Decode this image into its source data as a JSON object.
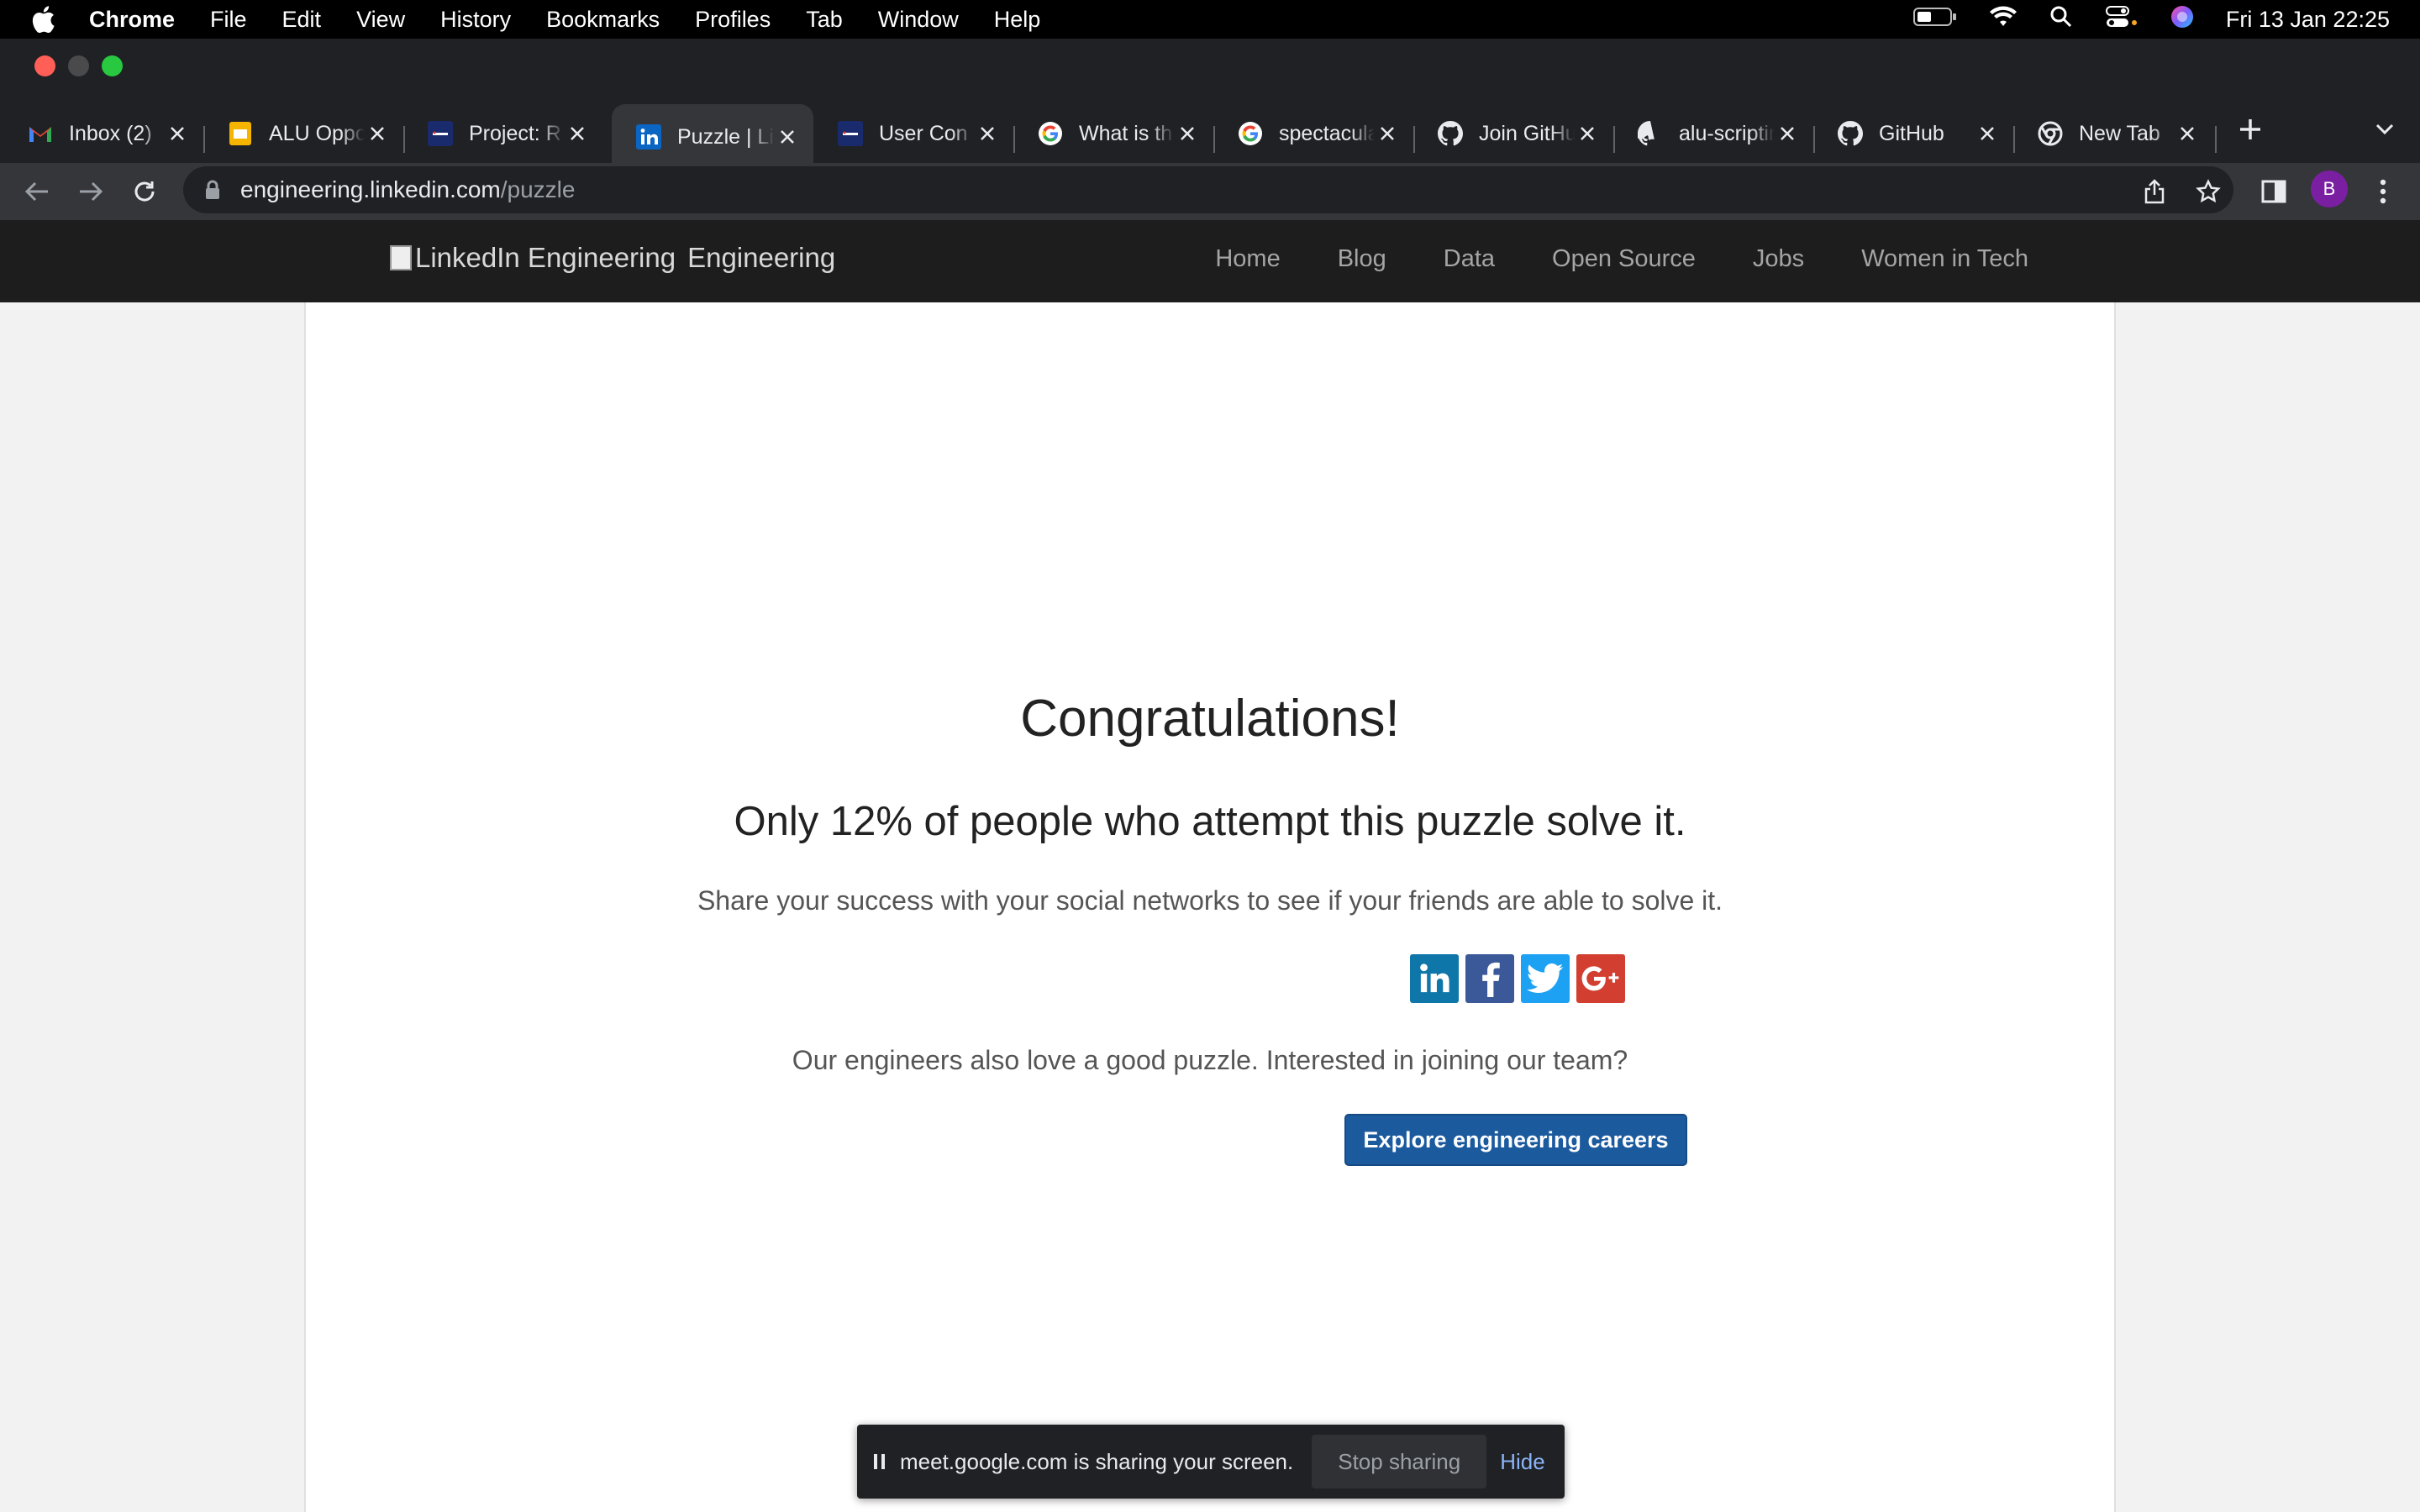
{
  "menubar": {
    "app": "Chrome",
    "items": [
      "File",
      "Edit",
      "View",
      "History",
      "Bookmarks",
      "Profiles",
      "Tab",
      "Window",
      "Help"
    ],
    "clock": "Fri 13 Jan  22:25"
  },
  "tabs": [
    {
      "title": "Inbox (2)",
      "icon": "gmail-icon"
    },
    {
      "title": "ALU Opportunities",
      "icon": "slides-icon"
    },
    {
      "title": "Project: R",
      "icon": "alu-icon"
    },
    {
      "title": "Puzzle | LinkedIn",
      "icon": "linkedin-icon",
      "active": true
    },
    {
      "title": "User Con",
      "icon": "alu-icon"
    },
    {
      "title": "What is th",
      "icon": "google-icon"
    },
    {
      "title": "spectacular",
      "icon": "google-icon"
    },
    {
      "title": "Join GitHub",
      "icon": "github-icon"
    },
    {
      "title": "alu-scripting",
      "icon": "github-icon"
    },
    {
      "title": "GitHub",
      "icon": "github-icon"
    },
    {
      "title": "New Tab",
      "icon": "chrome-icon"
    }
  ],
  "omnibox": {
    "host": "engineering.linkedin.com",
    "path": "/puzzle"
  },
  "profile": {
    "initial": "B",
    "color": "#7b1fa2"
  },
  "site": {
    "logo_alt": "LinkedIn Engineering",
    "logo_text": "Engineering",
    "nav": [
      "Home",
      "Blog",
      "Data",
      "Open Source",
      "Jobs",
      "Women in Tech"
    ]
  },
  "content": {
    "heading": "Congratulations!",
    "subheading": "Only 12% of people who attempt this puzzle solve it.",
    "share_text": "Share your success with your social networks to see if your friends are able to solve it.",
    "social": [
      {
        "name": "linkedin",
        "color": "#0e76a8"
      },
      {
        "name": "facebook",
        "color": "#3b5998"
      },
      {
        "name": "twitter",
        "color": "#1da1f2"
      },
      {
        "name": "google-plus",
        "color": "#d23f31"
      }
    ],
    "join_text": "Our engineers also love a good puzzle. Interested in joining our team?",
    "cta": "Explore engineering careers"
  },
  "sharebar": {
    "message": "meet.google.com is sharing your screen.",
    "stop": "Stop sharing",
    "hide": "Hide"
  }
}
